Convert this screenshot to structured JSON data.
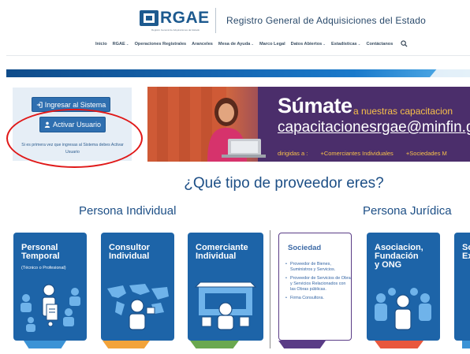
{
  "header": {
    "logo_text": "RGAE",
    "logo_subtext": "Registro General de Adquisiciones del Estado",
    "site_title": "Registro General de Adquisiciones del Estado"
  },
  "nav": {
    "items": [
      {
        "label": "Inicio",
        "dropdown": false
      },
      {
        "label": "RGAE",
        "dropdown": true
      },
      {
        "label": "Operaciones Registrales",
        "dropdown": false
      },
      {
        "label": "Aranceles",
        "dropdown": false
      },
      {
        "label": "Mesa de Ayuda",
        "dropdown": true
      },
      {
        "label": "Marco Legal",
        "dropdown": false
      },
      {
        "label": "Datos Abiertos",
        "dropdown": true
      },
      {
        "label": "Estadísticas",
        "dropdown": true
      },
      {
        "label": "Contáctanos",
        "dropdown": false
      }
    ],
    "search_icon": "search-icon"
  },
  "login": {
    "ingresar_label": "Ingresar al Sistema",
    "activar_label": "Activar Usuario",
    "note": "Si es primera vez que ingresas al Sistema debes Activar Usuario"
  },
  "banner": {
    "headline": "Súmate",
    "headline_rest": "a nuestras capacitacion",
    "email": "capacitacionesrgae@minfin.g",
    "footer_prefix": "dirigidas a :",
    "footer_item1": "+Comerciantes Individuales",
    "footer_item2": "+Sociedades M"
  },
  "main": {
    "question": "¿Qué tipo de proveedor eres?",
    "individual_heading": "Persona Individual",
    "juridica_heading": "Persona Jurídica"
  },
  "cards": [
    {
      "title": "Personal\nTemporal",
      "subtitle": "(Técnico o Profesional)",
      "bar_color": "#3b93d6"
    },
    {
      "title": "Consultor\nIndividual",
      "subtitle": "",
      "bar_color": "#f2a33a"
    },
    {
      "title": "Comerciante\nIndividual",
      "subtitle": "",
      "bar_color": "#6aa84f"
    },
    {
      "title": "Asociacion,\nFundación\ny ONG",
      "subtitle": "",
      "bar_color": "#e8573d"
    },
    {
      "title": "So\nEx",
      "subtitle": "",
      "bar_color": "#3b93d6"
    }
  ],
  "sociedad": {
    "title": "Sociedad",
    "items": [
      "Proveedor de Bienes, Suministros y Servicios.",
      "Proveedor de Servicios de Obra y Servicios Relacionados con las Obras públicas.",
      "Firma Consultora."
    ],
    "bar_color": "#5a3c86"
  },
  "colors": {
    "primary_blue": "#1d64a8",
    "heading_blue": "#1d4f86",
    "highlight_red": "#e01818",
    "banner_purple": "#4b2e6b",
    "banner_orange": "#cf5a36"
  }
}
